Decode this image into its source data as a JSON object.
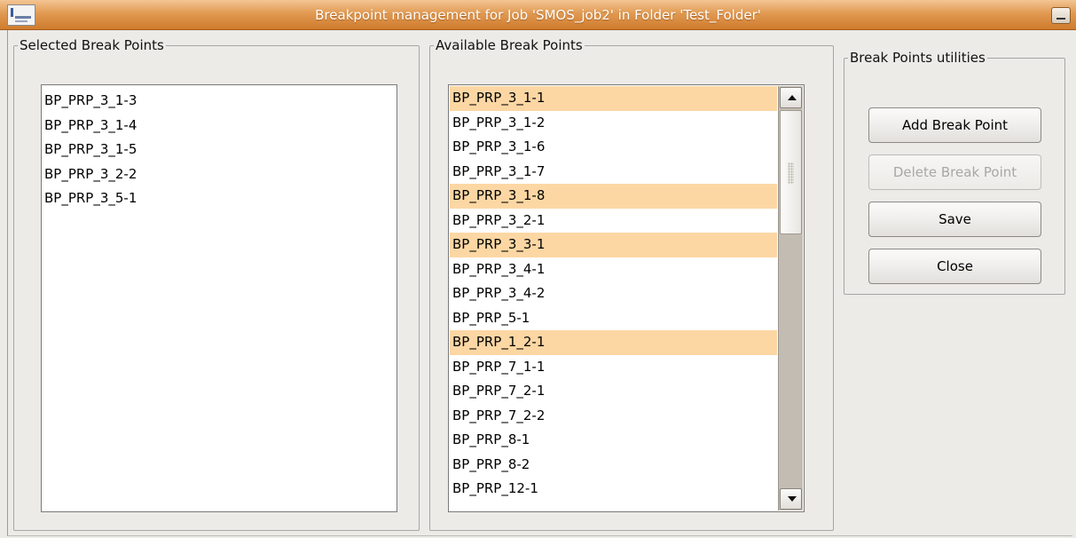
{
  "window": {
    "title": "Breakpoint management for Job 'SMOS_job2' in Folder 'Test_Folder'",
    "icon": "app-logo-icon",
    "titlebar_color": "#e19a52"
  },
  "selected_panel": {
    "legend": "Selected Break Points",
    "items": [
      "BP_PRP_3_1-3",
      "BP_PRP_3_1-4",
      "BP_PRP_3_1-5",
      "BP_PRP_3_2-2",
      "BP_PRP_3_5-1"
    ]
  },
  "available_panel": {
    "legend": "Available Break Points",
    "selection_color": "#fcd7a4",
    "items": [
      {
        "label": "BP_PRP_3_1-1",
        "selected": true
      },
      {
        "label": "BP_PRP_3_1-2",
        "selected": false
      },
      {
        "label": "BP_PRP_3_1-6",
        "selected": false
      },
      {
        "label": "BP_PRP_3_1-7",
        "selected": false
      },
      {
        "label": "BP_PRP_3_1-8",
        "selected": true
      },
      {
        "label": "BP_PRP_3_2-1",
        "selected": false
      },
      {
        "label": "BP_PRP_3_3-1",
        "selected": true
      },
      {
        "label": "BP_PRP_3_4-1",
        "selected": false
      },
      {
        "label": "BP_PRP_3_4-2",
        "selected": false
      },
      {
        "label": "BP_PRP_5-1",
        "selected": false
      },
      {
        "label": "BP_PRP_1_2-1",
        "selected": true
      },
      {
        "label": "BP_PRP_7_1-1",
        "selected": false
      },
      {
        "label": "BP_PRP_7_2-1",
        "selected": false
      },
      {
        "label": "BP_PRP_7_2-2",
        "selected": false
      },
      {
        "label": "BP_PRP_8-1",
        "selected": false
      },
      {
        "label": "BP_PRP_8-2",
        "selected": false
      },
      {
        "label": "BP_PRP_12-1",
        "selected": false
      }
    ]
  },
  "utilities_panel": {
    "legend": "Break Points utilities",
    "add_label": "Add Break Point",
    "delete_label": "Delete Break Point",
    "save_label": "Save",
    "close_label": "Close"
  }
}
